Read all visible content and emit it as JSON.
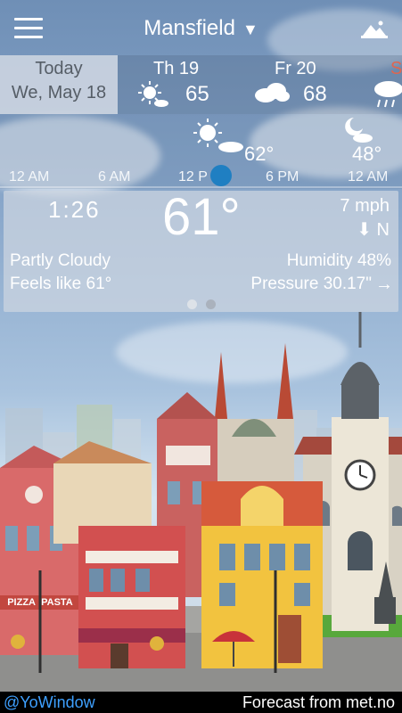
{
  "header": {
    "city": "Mansfield",
    "dropdown_glyph": "▼"
  },
  "days": [
    {
      "line1": "Today",
      "line2": "We, May 18"
    },
    {
      "label": "Th 19",
      "temp": "65",
      "icon": "sunny-partly-cloudy-icon"
    },
    {
      "label": "Fr 20",
      "temp": "68",
      "icon": "cloudy-icon"
    },
    {
      "label": "S",
      "icon": "rain-icon"
    }
  ],
  "hourly": {
    "labels": [
      "12 AM",
      "6 AM",
      "12 P",
      "6 PM",
      "12 AM"
    ],
    "day_temp": "62°",
    "night_temp": "48°"
  },
  "current": {
    "time": "1:26",
    "temp": "61°",
    "wind_speed": "7 mph",
    "wind_dir": "N",
    "condition": "Partly Cloudy",
    "feels_like": "Feels like 61°",
    "humidity": "Humidity 48%",
    "pressure": "Pressure 30.17\"",
    "pressure_trend_glyph": "→"
  },
  "footer": {
    "left": "@YoWindow",
    "right": "Forecast from met.no"
  },
  "colors": {
    "accent": "#1f7fc2",
    "link": "#3ea0ff"
  }
}
